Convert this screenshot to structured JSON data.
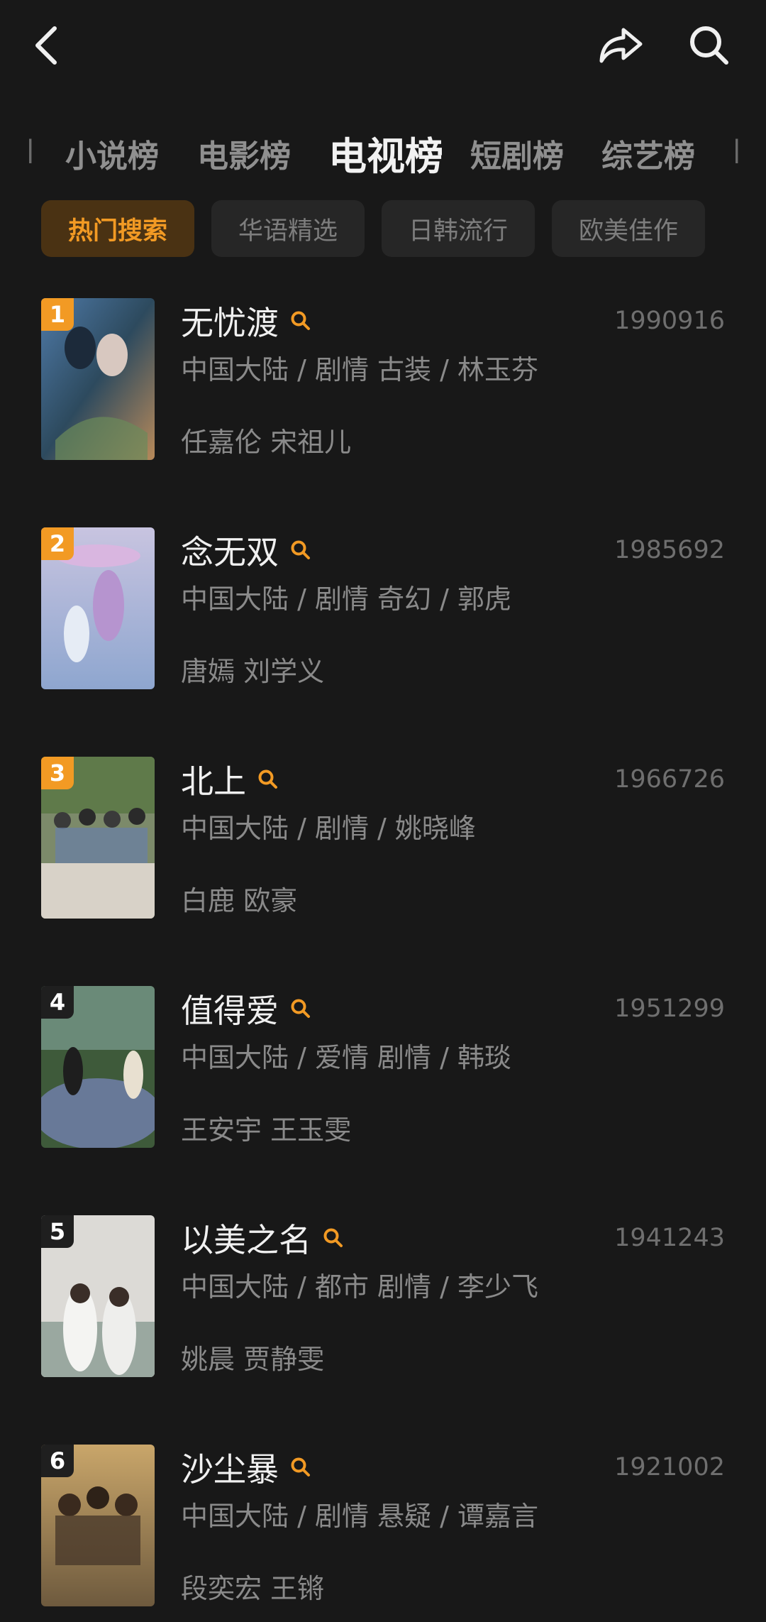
{
  "header": {
    "back_icon": "chevron-left-icon",
    "share_icon": "share-icon",
    "search_icon": "search-icon"
  },
  "category_tabs": [
    {
      "label": "小说榜",
      "active": false
    },
    {
      "label": "电影榜",
      "active": false
    },
    {
      "label": "电视榜",
      "active": true
    },
    {
      "label": "短剧榜",
      "active": false
    },
    {
      "label": "综艺榜",
      "active": false
    }
  ],
  "filter_chips": [
    {
      "label": "热门搜索",
      "active": true
    },
    {
      "label": "华语精选",
      "active": false
    },
    {
      "label": "日韩流行",
      "active": false
    },
    {
      "label": "欧美佳作",
      "active": false
    }
  ],
  "colors": {
    "accent": "#f29a24",
    "rank_top": "#f29a24",
    "rank_other": "#1f1f1f"
  },
  "items": [
    {
      "rank": "1",
      "title": "无忧渡",
      "count": "1990916",
      "meta": "中国大陆 / 剧情 古装 / 林玉芬",
      "cast": "任嘉伦 宋祖儿"
    },
    {
      "rank": "2",
      "title": "念无双",
      "count": "1985692",
      "meta": "中国大陆 / 剧情 奇幻 / 郭虎",
      "cast": "唐嫣 刘学义"
    },
    {
      "rank": "3",
      "title": "北上",
      "count": "1966726",
      "meta": "中国大陆 / 剧情 / 姚晓峰",
      "cast": "白鹿 欧豪"
    },
    {
      "rank": "4",
      "title": "值得爱",
      "count": "1951299",
      "meta": "中国大陆 / 爱情 剧情 / 韩琰",
      "cast": "王安宇 王玉雯"
    },
    {
      "rank": "5",
      "title": "以美之名",
      "count": "1941243",
      "meta": "中国大陆 / 都市 剧情 / 李少飞",
      "cast": "姚晨 贾静雯"
    },
    {
      "rank": "6",
      "title": "沙尘暴",
      "count": "1921002",
      "meta": "中国大陆 / 剧情 悬疑 / 谭嘉言",
      "cast": "段奕宏 王锵"
    }
  ]
}
